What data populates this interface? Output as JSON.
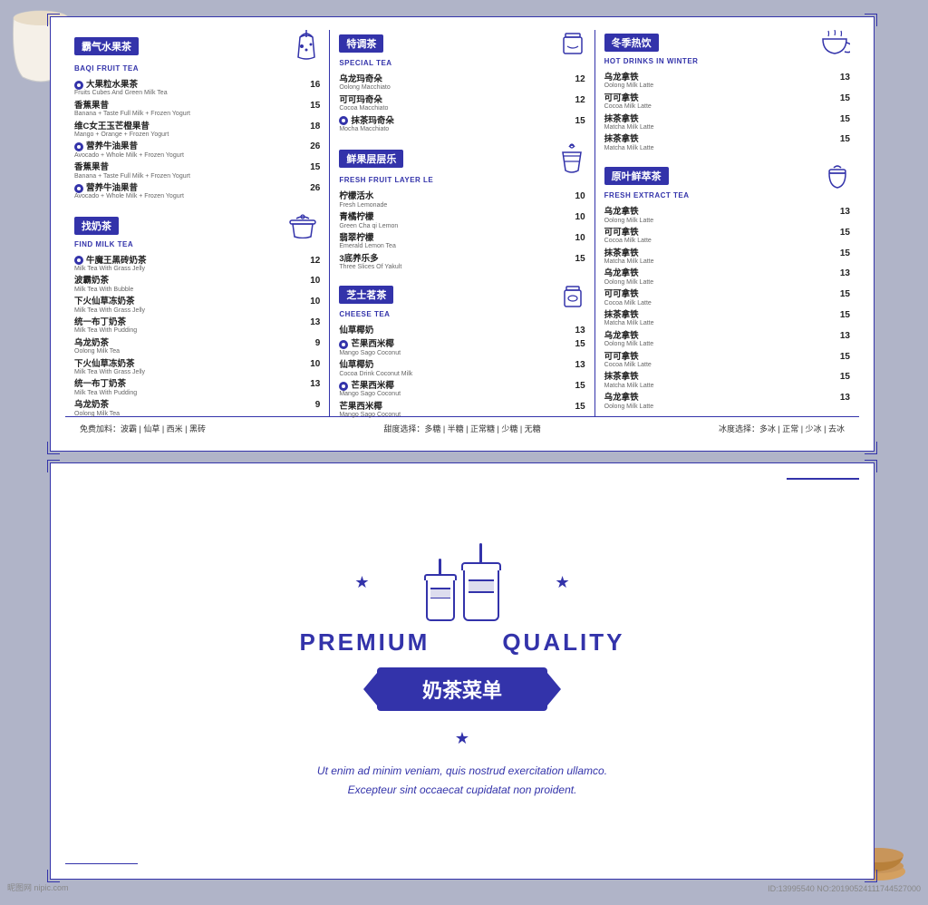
{
  "page": {
    "bg_color": "#b0b4c8"
  },
  "menu_card_top": {
    "col1": {
      "title_cn": "霸气水果茶",
      "title_en": "BAQI FRUIT TEA",
      "items": [
        {
          "name_cn": "大果粒水果茶",
          "name_en": "Fruits Cubes And Green Milk Tea",
          "price": "16",
          "highlight": true
        },
        {
          "name_cn": "香蕉果昔",
          "name_en": "Banana + Taste Full Milk + Frozen Yogurt",
          "price": "15"
        },
        {
          "name_cn": "维C女王玉芒橙果昔",
          "name_en": "Mango + Orange + Frozen Yogurt",
          "price": "18"
        },
        {
          "name_cn": "营养牛油果昔",
          "name_en": "Avocado + Whole Milk + Frozen Yogurt",
          "price": "26",
          "highlight": true
        },
        {
          "name_cn": "香蕉果昔",
          "name_en": "Banana + Taste Full Milk + Frozen Yogurt",
          "price": "15"
        },
        {
          "name_cn": "营养牛油果昔",
          "name_en": "Avocado + Whole Milk + Frozen Yogurt",
          "price": "26",
          "highlight": true
        }
      ],
      "col2_title_cn": "找奶茶",
      "col2_title_en": "FIND MILK TEA",
      "col2_items": [
        {
          "name_cn": "牛魔王黑砖奶茶",
          "name_en": "Milk Tea With Grass Jelly",
          "price": "12",
          "highlight": true
        },
        {
          "name_cn": "波霸奶茶",
          "name_en": "Milk Tea With Bubble",
          "price": "10"
        },
        {
          "name_cn": "下火仙草冻奶茶",
          "name_en": "Milk Tea With Grass Jelly",
          "price": "10"
        },
        {
          "name_cn": "统一布丁奶茶",
          "name_en": "Milk Tea With Pudding",
          "price": "13"
        },
        {
          "name_cn": "乌龙奶茶",
          "name_en": "Oolong Milk Tea",
          "price": "9"
        },
        {
          "name_cn": "下火仙草冻奶茶",
          "name_en": "Milk Tea With Grass Jelly",
          "price": "10"
        },
        {
          "name_cn": "统一布丁奶茶",
          "name_en": "Milk Tea With Pudding",
          "price": "13"
        },
        {
          "name_cn": "乌龙奶茶",
          "name_en": "Oolong Milk Tea",
          "price": "9"
        }
      ]
    },
    "col2": {
      "title_cn": "特调茶",
      "title_en": "SPECIAL TEA",
      "items": [
        {
          "name_cn": "乌龙玛奇朵",
          "name_en": "Oolong Macchiato",
          "price": "12"
        },
        {
          "name_cn": "可可玛奇朵",
          "name_en": "Cocoa Macchiato",
          "price": "12"
        },
        {
          "name_cn": "抹茶玛奇朵",
          "name_en": "Mocha Macchiato",
          "price": "15",
          "highlight": true
        }
      ],
      "title2_cn": "鲜果层层乐",
      "title2_en": "FRESH FRUIT LAYER LE",
      "items2": [
        {
          "name_cn": "柠檬活水",
          "name_en": "Fresh Lemonade",
          "price": "10"
        },
        {
          "name_cn": "青橘柠檬",
          "name_en": "Green Cha qi Lemon",
          "price": "10"
        },
        {
          "name_cn": "翡翠柠檬",
          "name_en": "Emerald Lemon Tea",
          "price": "10"
        },
        {
          "name_cn": "3底养乐多",
          "name_en": "Three Slices Of Yakult",
          "price": "15"
        }
      ],
      "title3_cn": "芝士茗茶",
      "title3_en": "CHEESE TEA",
      "items3": [
        {
          "name_cn": "仙草椰奶",
          "name_en": "",
          "price": "13"
        },
        {
          "name_cn": "芒果西米椰",
          "name_en": "Mango Sago Coconut",
          "price": "15",
          "highlight": true
        },
        {
          "name_cn": "仙草椰奶",
          "name_en": "Cocoa Drink Coconut Milk",
          "price": "13"
        },
        {
          "name_cn": "芒果西米椰",
          "name_en": "Mango Sago Coconut",
          "price": "15",
          "highlight": true
        },
        {
          "name_cn": "芒果西米椰",
          "name_en": "Mango Sago Coconut",
          "price": "15"
        }
      ]
    },
    "col3": {
      "title_cn": "冬季热饮",
      "title_en": "HOT DRINKS IN WINTER",
      "items": [
        {
          "name_cn": "乌龙拿铁",
          "name_en": "Oolong Milk Latte",
          "price": "13"
        },
        {
          "name_cn": "可可拿铁",
          "name_en": "Cocoa Milk Latte",
          "price": "15"
        },
        {
          "name_cn": "抹茶拿铁",
          "name_en": "Matcha Milk Latte",
          "price": "15"
        },
        {
          "name_cn": "抹茶拿铁",
          "name_en": "Matcha Milk Latte",
          "price": "15"
        }
      ],
      "title2_cn": "原叶鲜萃茶",
      "title2_en": "FRESH EXTRACT TEA",
      "items2": [
        {
          "name_cn": "乌龙拿铁",
          "name_en": "Oolong Milk Latte",
          "price": "13"
        },
        {
          "name_cn": "可可拿铁",
          "name_en": "Cocoa Milk Latte",
          "price": "15"
        },
        {
          "name_cn": "抹茶拿铁",
          "name_en": "Matcha Milk Latte",
          "price": "15"
        },
        {
          "name_cn": "乌龙拿铁",
          "name_en": "Oolong Milk Latte",
          "price": "13"
        },
        {
          "name_cn": "可可拿铁",
          "name_en": "Cocoa Milk Latte",
          "price": "15"
        },
        {
          "name_cn": "抹茶拿铁",
          "name_en": "Matcha Milk Latte",
          "price": "15"
        },
        {
          "name_cn": "乌龙拿铁",
          "name_en": "Oolong Milk Latte",
          "price": "13"
        },
        {
          "name_cn": "可可拿铁",
          "name_en": "Cocoa Milk Latte",
          "price": "15"
        },
        {
          "name_cn": "抹茶拿铁",
          "name_en": "Matcha Milk Latte",
          "price": "15"
        },
        {
          "name_cn": "乌龙拿铁",
          "name_en": "Oolong Milk Latte",
          "price": "13"
        }
      ]
    },
    "footer": {
      "left": "免费加料：波霸 | 仙草 | 西米 | 黑砖",
      "center": "甜度选择：多糖 | 半糖 | 正常糖 | 少糖 | 无糖",
      "right": "冰度选择：多冰 | 正常 | 少冰 | 去冰"
    }
  },
  "menu_card_bottom": {
    "premium": "PREMIUM",
    "quality": "QUALITY",
    "title": "奶茶菜单",
    "tagline_line1": "Ut enim ad minim veniam, quis nostrud exercitation ullamco.",
    "tagline_line2": "Excepteur sint occaecat cupidatat non proident."
  },
  "watermarks": {
    "bl": "昵图网 nipic.com",
    "br": "ID:13995540 NO:20190524111744527000"
  }
}
